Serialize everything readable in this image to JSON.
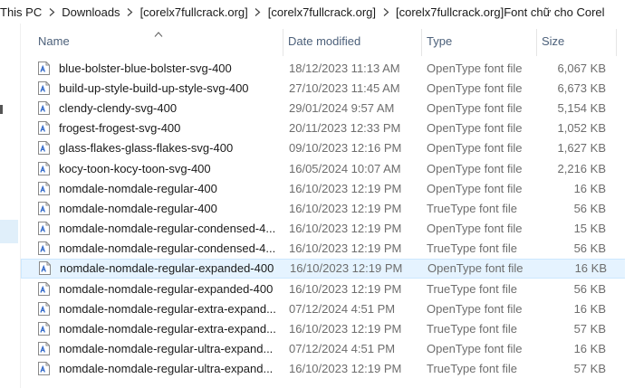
{
  "breadcrumb": {
    "items": [
      "This PC",
      "Downloads",
      "[corelx7fullcrack.org]",
      "[corelx7fullcrack.org]",
      "[corelx7fullcrack.org]Font chữ cho Corel"
    ]
  },
  "columns": {
    "name": "Name",
    "date": "Date modified",
    "type": "Type",
    "size": "Size"
  },
  "files": [
    {
      "name": "blue-bolster-blue-bolster-svg-400",
      "date": "18/12/2023 11:13 AM",
      "type": "OpenType font file",
      "size": "6,067 KB"
    },
    {
      "name": "build-up-style-build-up-style-svg-400",
      "date": "27/10/2023 11:45 AM",
      "type": "OpenType font file",
      "size": "6,673 KB"
    },
    {
      "name": "clendy-clendy-svg-400",
      "date": "29/01/2024 9:57 AM",
      "type": "OpenType font file",
      "size": "5,154 KB"
    },
    {
      "name": "frogest-frogest-svg-400",
      "date": "20/11/2023 12:33 PM",
      "type": "OpenType font file",
      "size": "1,052 KB"
    },
    {
      "name": "glass-flakes-glass-flakes-svg-400",
      "date": "09/10/2023 12:16 PM",
      "type": "OpenType font file",
      "size": "1,627 KB"
    },
    {
      "name": "kocy-toon-kocy-toon-svg-400",
      "date": "16/05/2024 10:07 AM",
      "type": "OpenType font file",
      "size": "2,216 KB"
    },
    {
      "name": "nomdale-nomdale-regular-400",
      "date": "16/10/2023 12:19 PM",
      "type": "OpenType font file",
      "size": "16 KB"
    },
    {
      "name": "nomdale-nomdale-regular-400",
      "date": "16/10/2023 12:19 PM",
      "type": "TrueType font file",
      "size": "56 KB"
    },
    {
      "name": "nomdale-nomdale-regular-condensed-4...",
      "date": "16/10/2023 12:19 PM",
      "type": "OpenType font file",
      "size": "15 KB"
    },
    {
      "name": "nomdale-nomdale-regular-condensed-4...",
      "date": "16/10/2023 12:19 PM",
      "type": "TrueType font file",
      "size": "56 KB"
    },
    {
      "name": "nomdale-nomdale-regular-expanded-400",
      "date": "16/10/2023 12:19 PM",
      "type": "OpenType font file",
      "size": "16 KB"
    },
    {
      "name": "nomdale-nomdale-regular-expanded-400",
      "date": "16/10/2023 12:19 PM",
      "type": "TrueType font file",
      "size": "56 KB"
    },
    {
      "name": "nomdale-nomdale-regular-extra-expand...",
      "date": "07/12/2024 4:51 PM",
      "type": "OpenType font file",
      "size": "16 KB"
    },
    {
      "name": "nomdale-nomdale-regular-extra-expand...",
      "date": "16/10/2023 12:19 PM",
      "type": "TrueType font file",
      "size": "57 KB"
    },
    {
      "name": "nomdale-nomdale-regular-ultra-expand...",
      "date": "07/12/2024 4:51 PM",
      "type": "OpenType font file",
      "size": "16 KB"
    },
    {
      "name": "nomdale-nomdale-regular-ultra-expand...",
      "date": "16/10/2023 12:19 PM",
      "type": "TrueType font file",
      "size": "57 KB"
    }
  ],
  "selected_index": 10,
  "icons": {
    "file": "font-file-icon",
    "separator": "chevron-right-icon",
    "sort": "sort-up-caret-icon"
  },
  "colors": {
    "header_text": "#4c607a",
    "meta_text": "#6d6d6d",
    "selection_bg": "#e5f3ff",
    "selection_border": "#cce8ff",
    "icon_accent": "#2b63c6"
  }
}
